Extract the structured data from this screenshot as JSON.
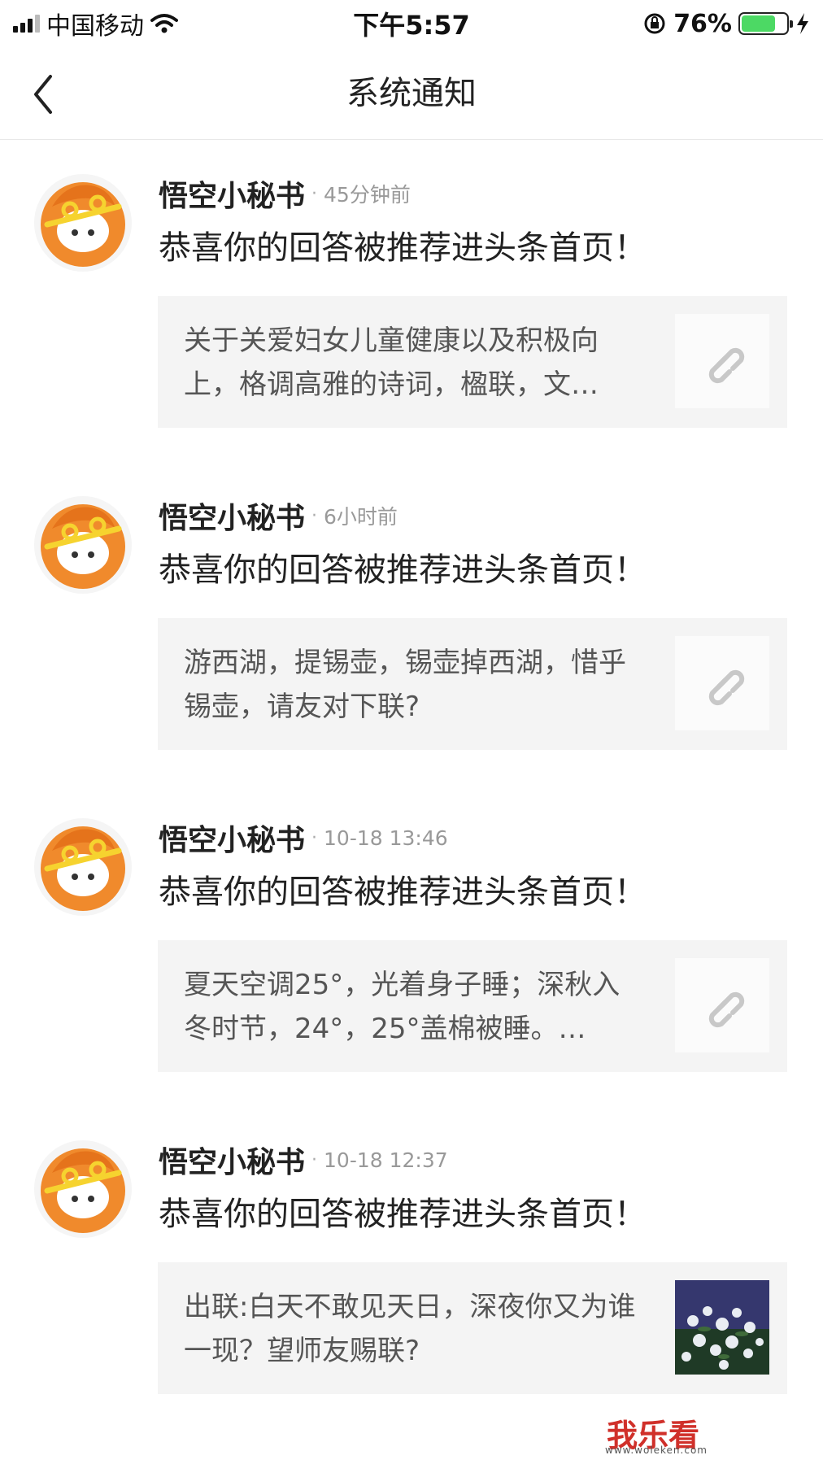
{
  "status_bar": {
    "carrier": "中国移动",
    "time": "下午5:57",
    "battery_percent": "76%",
    "battery_level": 0.76,
    "icons": [
      "signal-icon",
      "wifi-icon",
      "rotation-lock-icon",
      "battery-icon",
      "charging-bolt-icon"
    ]
  },
  "nav": {
    "title": "系统通知",
    "back_icon": "chevron-left-icon"
  },
  "notifications": [
    {
      "sender": "悟空小秘书",
      "time": "45分钟前",
      "message": "恭喜你的回答被推荐进头条首页！",
      "card_text": "关于关爱妇女儿童健康以及积极向上，格调高雅的诗词，楹联，文…",
      "thumb": "link-icon"
    },
    {
      "sender": "悟空小秘书",
      "time": "6小时前",
      "message": "恭喜你的回答被推荐进头条首页！",
      "card_text": "游西湖，提锡壶，锡壶掉西湖，惜乎锡壶，请友对下联?",
      "thumb": "link-icon"
    },
    {
      "sender": "悟空小秘书",
      "time": "10-18 13:46",
      "message": "恭喜你的回答被推荐进头条首页！",
      "card_text": "夏天空调25°，光着身子睡；深秋入冬时节，24°，25°盖棉被睡。…",
      "thumb": "link-icon"
    },
    {
      "sender": "悟空小秘书",
      "time": "10-18 12:37",
      "message": "恭喜你的回答被推荐进头条首页！",
      "card_text": "出联:白天不敢见天日，深夜你又为谁一现？望师友赐联?",
      "thumb": "flower-photo"
    }
  ],
  "watermark": {
    "text": "我乐看",
    "url": "www.woleken.com"
  },
  "colors": {
    "avatar_orange": "#f08a2c",
    "avatar_yellow": "#f6d32f",
    "card_bg": "#f4f4f4",
    "battery_green": "#4cd964",
    "watermark_red": "#d0302a"
  }
}
